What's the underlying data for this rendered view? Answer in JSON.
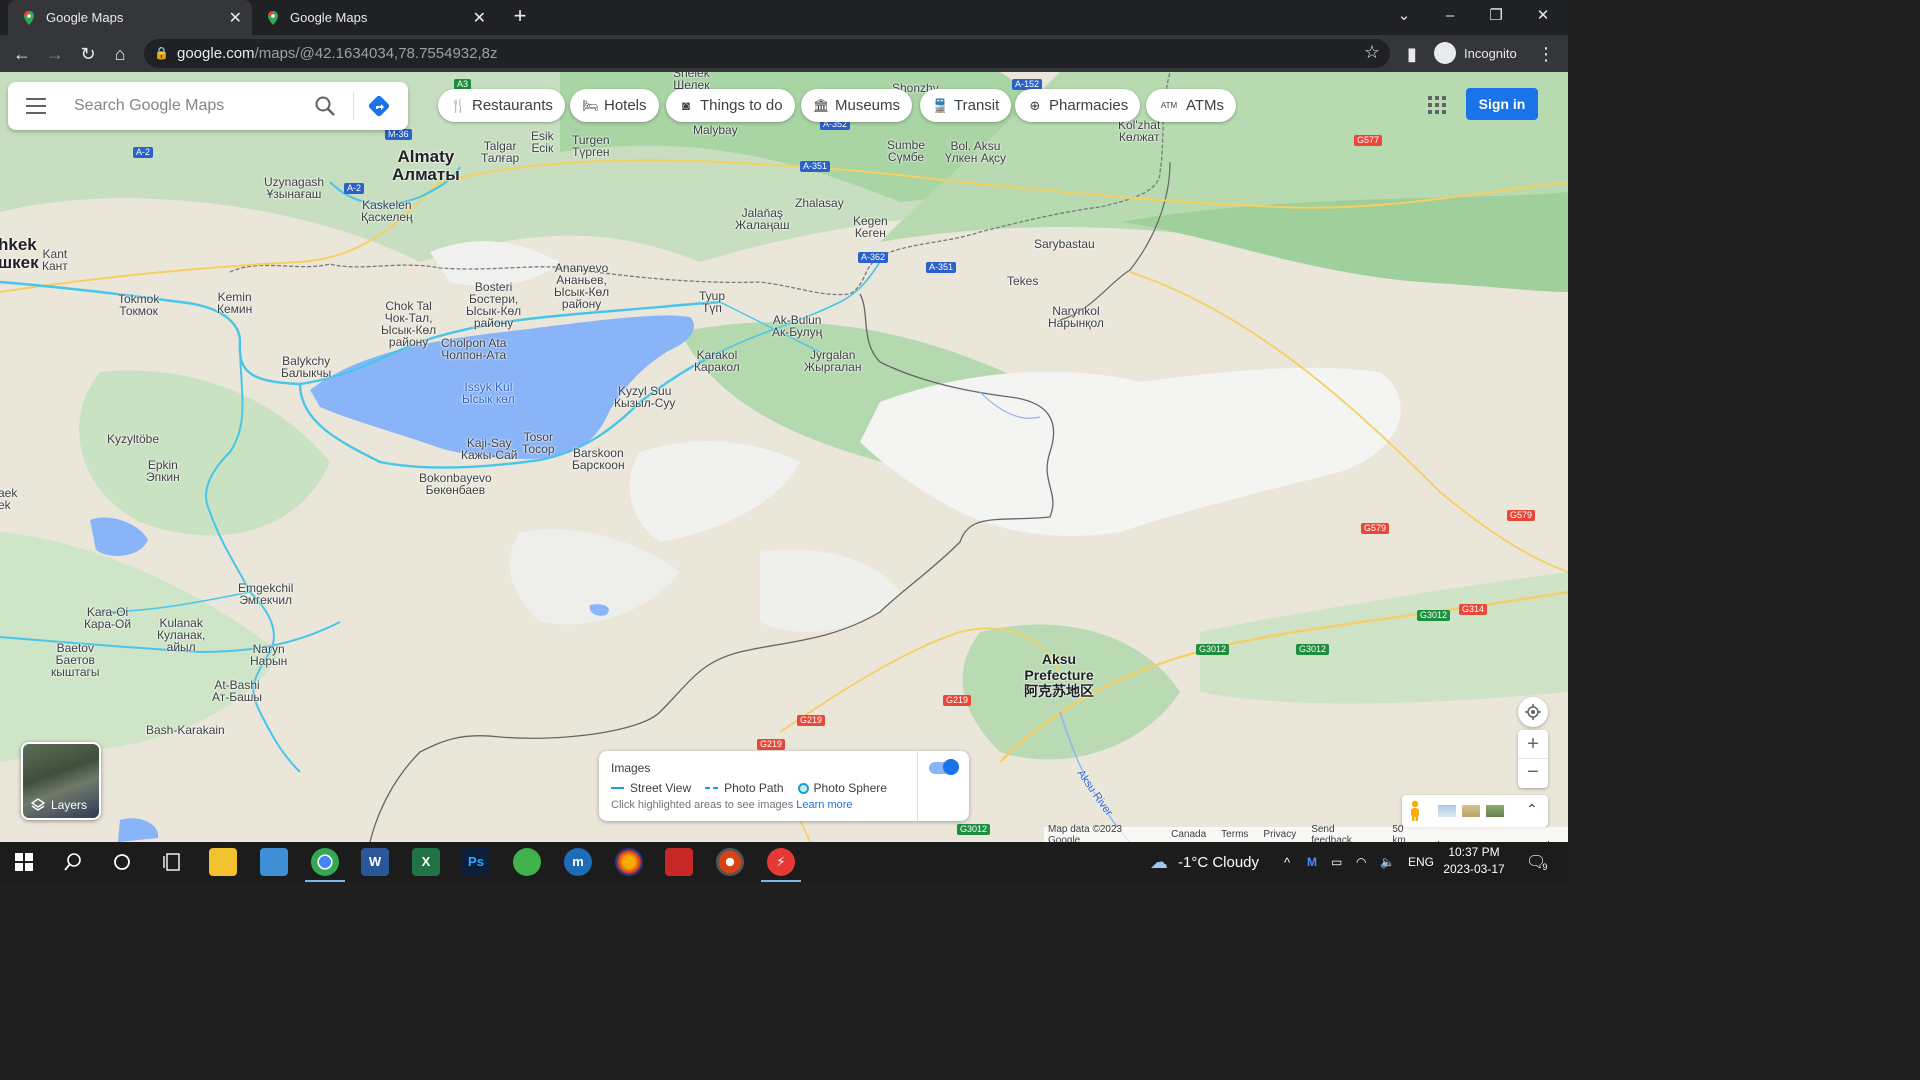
{
  "browser": {
    "tabs": [
      {
        "label": "Google Maps",
        "active": true
      },
      {
        "label": "Google Maps",
        "active": false
      }
    ],
    "url_host": "google.com",
    "url_path": "/maps/@42.1634034,78.7554932,8z",
    "profile_label": "Incognito"
  },
  "search": {
    "placeholder": "Search Google Maps"
  },
  "chips": [
    "Restaurants",
    "Hotels",
    "Things to do",
    "Museums",
    "Transit",
    "Pharmacies",
    "ATMs"
  ],
  "sign_in": "Sign in",
  "layers_label": "Layers",
  "legend": {
    "title": "Images",
    "street_view": "Street View",
    "photo_path": "Photo Path",
    "photo_sphere": "Photo Sphere",
    "hint": "Click highlighted areas to see images",
    "learn_more": "Learn more",
    "toggle_on": true
  },
  "footer": {
    "map_data": "Map data ©2023 Google",
    "country": "Canada",
    "terms": "Terms",
    "privacy": "Privacy",
    "feedback": "Send feedback",
    "scale": "50 km"
  },
  "places": {
    "almaty": "Almaty\nАлматы",
    "bishkek": "hkek\nшкек",
    "kant": "Kant\nКант",
    "tokmok": "Tokmok\nТокмок",
    "kemin": "Kemin\nКемин",
    "uzynagash": "Uzynagash\nҰзынағаш",
    "kaskelen": "Kaskelen\nҚаскелең",
    "talgar": "Talgar\nТалғар",
    "esik": "Esik\nЕсік",
    "turgen": "Turgen\nТүрген",
    "malybay": "Malybay",
    "shelek": "Shelek\nШелек",
    "shonzhy": "Shonzhy",
    "sumbe": "Sumbe\nСүмбе",
    "bol_aksu": "Bol. Aksu\nҮлкен Ақсу",
    "kolzhat": "Kol'zhat\nКөлжат",
    "zhalanash": "Jalaňaş\nЖалаңаш",
    "zhalasay": "Zhalasay",
    "kegen": "Kegen\nКеген",
    "sarybastau": "Sarybastau",
    "tekes": "Tekes",
    "narynkol": "Narynkol\nНарынқол",
    "ananyevo": "Ananyevo\nАнаньев,\nЫсык-Көл\nрайону",
    "bosteri": "Bosteri\nБостери,\nЫсык-Көл\nрайону",
    "chok_tal": "Chok Tal\nЧок-Тал,\nЫсык-Көл\nрайону",
    "cholpon_ata": "Cholpon Ata\nЧолпон-Ата",
    "tyup": "Tyup\nТүп",
    "ak_bulun": "Ak-Bulun\nАк-Булуң",
    "karakol": "Karakol\nКаракол",
    "jyrgalan": "Jyrgalan\nЖыргалан",
    "balykchy": "Balykchy\nБалыкчы",
    "issyk_kul": "Issyk Kul\nЫсык көл",
    "kyzyl_suu": "Kyzyl Suu\nКызыл-Суу",
    "kaji_say": "Kaji-Say\nКажы-Сай",
    "tosor": "Tosor\nТосор",
    "barskoon": "Barskoon\nБарскоон",
    "bokonbayevo": "Bokonbayevo\nБөкөнбаев",
    "kyzyltobe": "Kyzyltöbe",
    "epkin": "Epkin\nЭпкин",
    "aek": "aek\nek",
    "emgekchil": "Emgekchil\nЭмгекчил",
    "kara_oi": "Kara-Oi\nКара-Ой",
    "kulanak": "Kulanak\nКуланак,\nайыл",
    "baetov": "Baetov\nБаетов\nкыштагы",
    "naryn": "Naryn\nНарын",
    "at_bashi": "At-Bashi\nАт-Башы",
    "bash_karakain": "Bash-Karakain",
    "aksu": "Aksu\nPrefecture\n阿克苏地区",
    "aksu_river": "Aksu River"
  },
  "roads": [
    "A3",
    "A-2",
    "M-36",
    "A-2",
    "A-352",
    "A-351",
    "A-351",
    "A-362",
    "A-351",
    "A-152",
    "G577",
    "G579",
    "G579",
    "G314",
    "G3012",
    "G3012",
    "G3012",
    "G3012",
    "G219",
    "G219",
    "G219",
    "G3012"
  ],
  "taskbar": {
    "weather": "-1°C  Cloudy",
    "lang": "ENG",
    "time": "10:37 PM",
    "date": "2023-03-17",
    "notif_count": "9"
  }
}
